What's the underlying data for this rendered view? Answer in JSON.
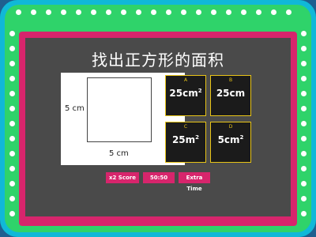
{
  "question": {
    "title": "找出正方形的面积",
    "figure": {
      "side_left": "5 cm",
      "side_bottom": "5 cm"
    }
  },
  "answers": [
    {
      "letter": "A",
      "value": "25cm",
      "sup": "2"
    },
    {
      "letter": "B",
      "value": "25cm",
      "sup": ""
    },
    {
      "letter": "C",
      "value": "25m",
      "sup": "2"
    },
    {
      "letter": "D",
      "value": "5cm",
      "sup": "2"
    }
  ],
  "powerups": {
    "score": "x2 Score",
    "fifty": "50:50",
    "time": "Extra Time"
  },
  "colors": {
    "frame_blue": "#10b8d8",
    "frame_green": "#2fd36a",
    "frame_pink": "#d7256c",
    "screen": "#4a4a4a",
    "answer_border": "#e8c417"
  }
}
